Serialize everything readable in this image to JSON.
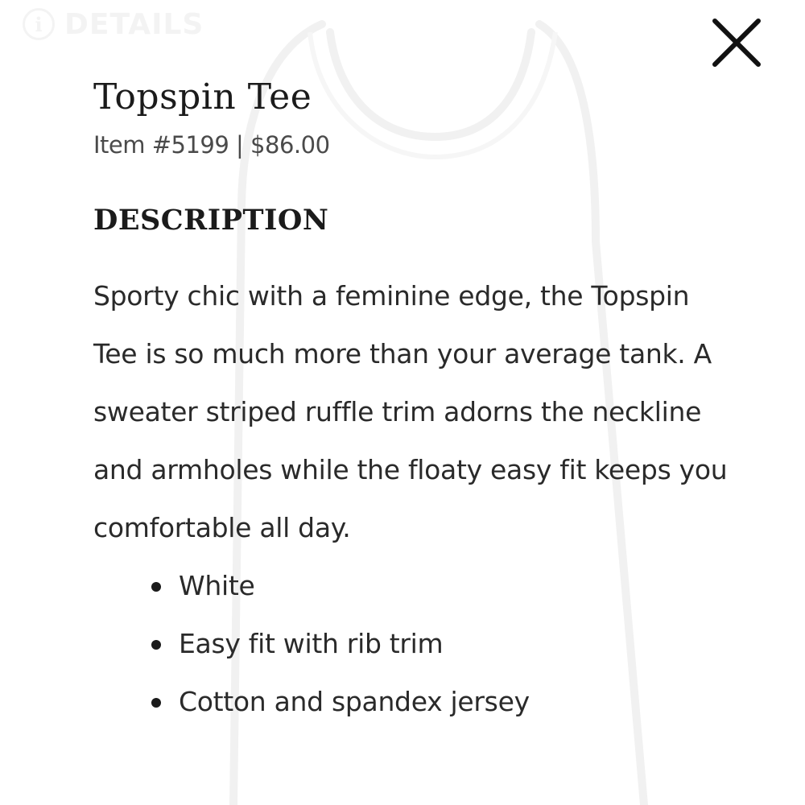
{
  "details_tab": {
    "icon": "info-icon",
    "label": "DETAILS"
  },
  "close": {
    "icon": "close-icon"
  },
  "product": {
    "title": "Topspin Tee",
    "meta": "Item #5199 | $86.00"
  },
  "description": {
    "heading": "DESCRIPTION",
    "text": "Sporty chic with a feminine edge, the Topspin Tee is so much more than your average tank. A sweater striped ruffle trim adorns the neckline and armholes while the floaty easy fit keeps you comfortable all day.",
    "features": [
      "White",
      "Easy fit with rib trim",
      "Cotton and spandex jersey"
    ]
  },
  "colors": {
    "text": "#1b1b1b",
    "muted": "#4a4a4a",
    "faint": "#e6e6e6"
  }
}
